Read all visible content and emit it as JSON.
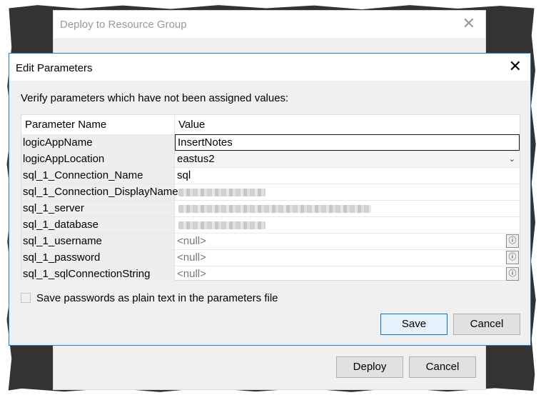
{
  "background_dialog": {
    "title": "Deploy to Resource Group",
    "close_glyph": "✕",
    "deploy_label": "Deploy",
    "cancel_label": "Cancel"
  },
  "dialog": {
    "title": "Edit Parameters",
    "close_glyph": "✕",
    "instruction": "Verify parameters which have not been assigned values:",
    "grid": {
      "headers": {
        "name": "Parameter Name",
        "value": "Value"
      },
      "rows": [
        {
          "name": "logicAppName",
          "value": "InsertNotes",
          "kind": "editing"
        },
        {
          "name": "logicAppLocation",
          "value": "eastus2",
          "kind": "combo"
        },
        {
          "name": "sql_1_Connection_Name",
          "value": "sql",
          "kind": "text"
        },
        {
          "name": "sql_1_Connection_DisplayName",
          "value": "",
          "kind": "blurred"
        },
        {
          "name": "sql_1_server",
          "value": "",
          "kind": "blurred"
        },
        {
          "name": "sql_1_database",
          "value": "",
          "kind": "blurred"
        },
        {
          "name": "sql_1_username",
          "value": "<null>",
          "kind": "null"
        },
        {
          "name": "sql_1_password",
          "value": "<null>",
          "kind": "null"
        },
        {
          "name": "sql_1_sqlConnectionString",
          "value": "<null>",
          "kind": "null"
        }
      ]
    },
    "save_passwords_label": "Save passwords as plain text in the parameters file",
    "save_passwords_checked": false,
    "save_label": "Save",
    "cancel_label": "Cancel",
    "icons": {
      "dropdown": "chevron-down-icon",
      "keyvault": "key-vault-reference-icon",
      "close": "close-icon"
    }
  },
  "colors": {
    "accent": "#0078d7",
    "dialog_border": "#1e7fd2",
    "frame": "#333333"
  }
}
